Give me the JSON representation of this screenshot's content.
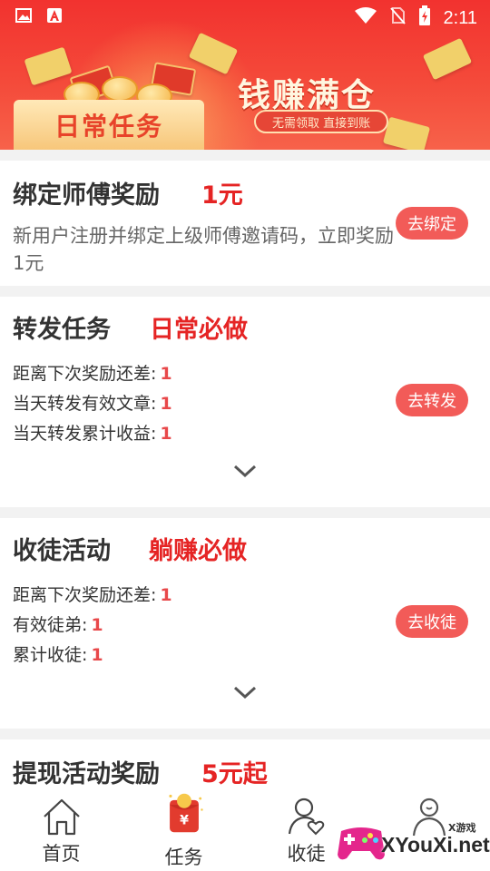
{
  "status_bar": {
    "time": "2:11"
  },
  "banner": {
    "box_label": "日常任务",
    "slogan": "钱赚满仓",
    "subline": "无需领取 直接到账"
  },
  "cards": [
    {
      "title": "绑定师傅奖励",
      "badge": "1元",
      "desc": "新用户注册并绑定上级师傅邀请码，立即奖励1元",
      "button": "去绑定"
    },
    {
      "title": "转发任务",
      "badge": "日常必做",
      "rows": [
        {
          "label": "距离下次奖励还差:",
          "value": "1"
        },
        {
          "label": "当天转发有效文章:",
          "value": "1"
        },
        {
          "label": "当天转发累计收益:",
          "value": "1"
        }
      ],
      "button": "去转发"
    },
    {
      "title": "收徒活动",
      "badge": "躺赚必做",
      "rows": [
        {
          "label": "距离下次奖励还差:",
          "value": "1"
        },
        {
          "label": "有效徒弟:",
          "value": "1"
        },
        {
          "label": "累计收徒:",
          "value": "1"
        }
      ],
      "button": "去收徒"
    },
    {
      "title": "提现活动奖励",
      "badge": "5元起"
    }
  ],
  "tabs": [
    {
      "label": "首页"
    },
    {
      "label": "任务",
      "active": true
    },
    {
      "label": "收徒"
    },
    {
      "label": ""
    }
  ],
  "watermark": {
    "site": "XYouXi.net",
    "small": "X游戏"
  },
  "colors": {
    "accent": "#f25b58",
    "badge": "#e52424",
    "banner": "#f2322f"
  }
}
